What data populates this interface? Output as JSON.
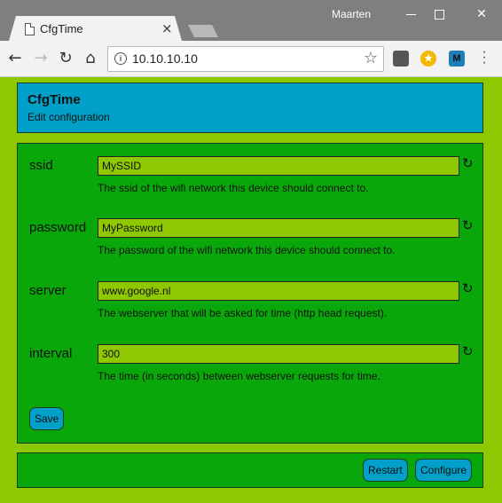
{
  "browser": {
    "tab_title": "CfgTime",
    "tab_close": "×",
    "profile_name": "Maarten",
    "url": "10.10.10.10",
    "window_close": "✕",
    "nav": {
      "back": "←",
      "forward": "→",
      "reload": "↻",
      "home": "⌂"
    },
    "star": "☆",
    "extensions": [
      "",
      "★",
      "M"
    ],
    "menu": "⋮"
  },
  "app": {
    "title": "CfgTime",
    "subtitle": "Edit configuration"
  },
  "fields": [
    {
      "label": "ssid",
      "value": "MySSID",
      "help": "The ssid of the wifi network this device should connect to."
    },
    {
      "label": "password",
      "value": "MyPassword",
      "help": "The password of the wifi network this device should connect to."
    },
    {
      "label": "server",
      "value": "www.google.nl",
      "help": "The webserver that will be asked for time (http head request)."
    },
    {
      "label": "interval",
      "value": "300",
      "help": "The time (in seconds) between webserver requests for time."
    }
  ],
  "reset_glyph": "↻",
  "buttons": {
    "save": "Save",
    "restart": "Restart",
    "configure": "Configure"
  },
  "colors": {
    "page_background": "#8dc800",
    "header_background": "#00a0c8",
    "panel_background": "#0aa70a",
    "input_background": "#8dc800",
    "button_background": "#00a0c8"
  }
}
